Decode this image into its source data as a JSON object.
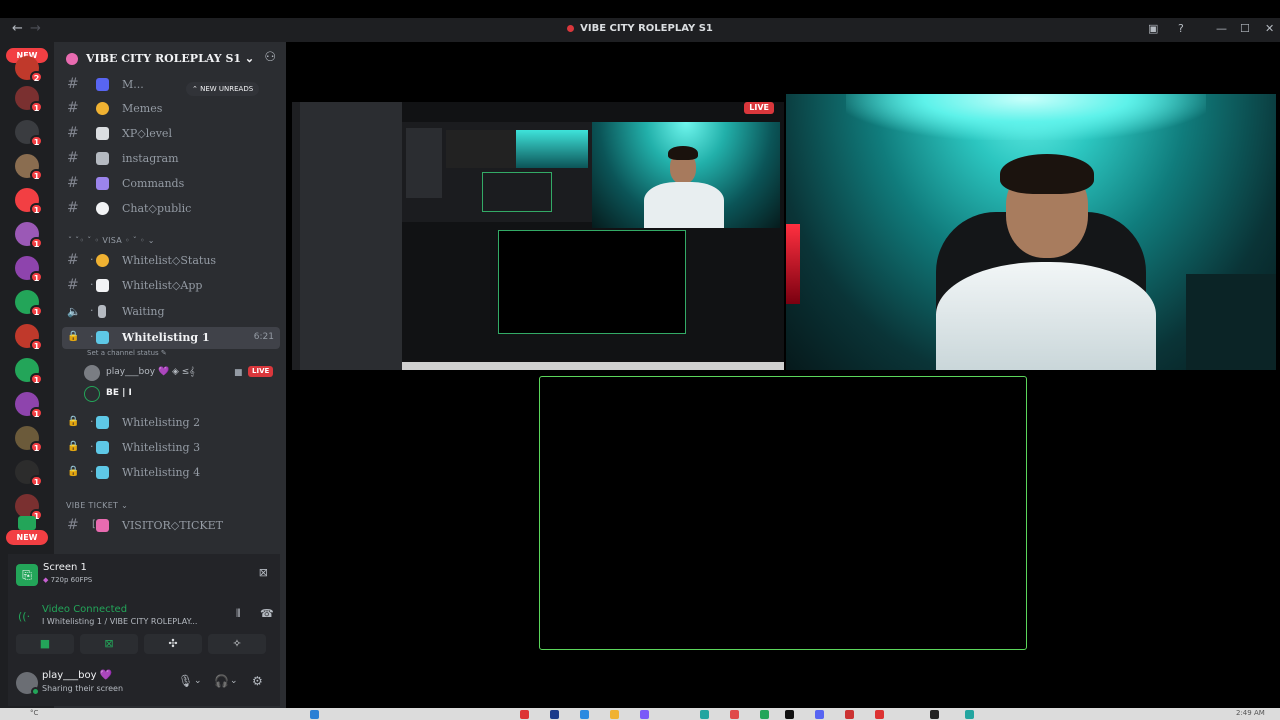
{
  "window": {
    "title": "VIBE CITY ROLEPLAY S1",
    "back_icon": "←",
    "forward_icon": "→"
  },
  "server_rail": {
    "new_top": "NEW",
    "new_bottom": "NEW",
    "badges": [
      "2",
      "1",
      "1",
      "1",
      "1",
      "1",
      "1",
      "1",
      "1",
      "1",
      "1",
      "1",
      "1",
      "1"
    ]
  },
  "sidebar": {
    "server_name": "VIBE CITY ROLEPLAY S1",
    "new_unreads": "NEW UNREADS",
    "channels": [
      {
        "label": "M..."
      },
      {
        "label": "Memes"
      },
      {
        "label": "XP◇level"
      },
      {
        "label": "instagram"
      },
      {
        "label": "Commands"
      },
      {
        "label": "Chat◇public"
      }
    ],
    "category_visa": "VISA",
    "visa_channels": [
      {
        "label": "Whitelist◇Status"
      },
      {
        "label": "Whitelist◇App"
      }
    ],
    "voice": {
      "waiting": "Waiting",
      "active": "Whitelisting 1",
      "active_timer": "6:21",
      "status_hint": "Set a channel status",
      "users": [
        {
          "name": "play___boy 💜 ◈ ≤𝄞",
          "live": "LIVE"
        },
        {
          "name": "BE | I"
        }
      ],
      "others": [
        "Whitelisting 2",
        "Whitelisting 3",
        "Whitelisting 4"
      ]
    },
    "category_ticket": "VIBE TICKET",
    "ticket_channel": "VISITOR◇TICKET"
  },
  "panel": {
    "screen_title": "Screen 1",
    "screen_sub": "720p 60FPS",
    "connected": "Video Connected",
    "connected_channel": "I Whitelisting 1 / VIBE CITY ROLEPLAY...",
    "username": "play___boy 💜",
    "user_status": "Sharing their screen"
  },
  "stage": {
    "live_label": "LIVE"
  },
  "taskbar": {
    "weather": "°C",
    "time": "2:49 AM"
  }
}
